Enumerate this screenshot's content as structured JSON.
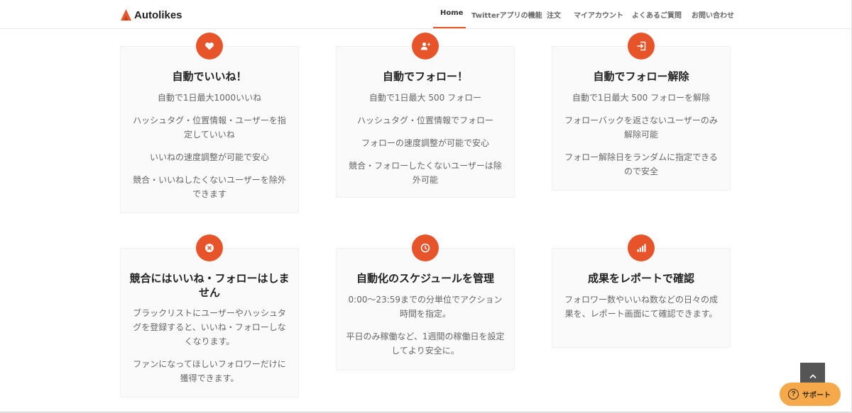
{
  "brand": {
    "name": "Autolikes"
  },
  "nav": {
    "items": [
      {
        "label": "Home",
        "active": true
      },
      {
        "label": "Twitterアプリの機能"
      },
      {
        "label": "注文"
      },
      {
        "label": "マイアカウント"
      },
      {
        "label": "よくあるご質問"
      },
      {
        "label": "お問い合わせ"
      }
    ]
  },
  "features": [
    {
      "icon": "heart-icon",
      "title": "自動でいいね！",
      "lines": [
        "自動で1日最大1000いいね",
        "ハッシュタグ・位置情報・ユーザーを指定していいね",
        "いいねの速度調整が可能で安心",
        "競合・いいねしたくないユーザーを除外できます"
      ]
    },
    {
      "icon": "add-user-icon",
      "title": "自動でフォロー！",
      "lines": [
        "自動で1日最大 500 フォロー",
        "ハッシュタグ・位置情報でフォロー",
        "フォローの速度調整が可能で安心",
        "競合・フォローしたくないユーザーは除外可能"
      ]
    },
    {
      "icon": "sign-in-icon",
      "title": "自動でフォロー解除",
      "lines": [
        "自動で1日最大 500 フォローを解除",
        "フォローバックを返さないユーザーのみ解除可能",
        "フォロー解除日をランダムに指定できるので安全"
      ]
    },
    {
      "icon": "close-circle-icon",
      "title": "競合にはいいね・フォローはしません",
      "lines": [
        "ブラックリストにユーザーやハッシュタグを登録すると、いいね・フォローしなくなります。",
        "ファンになってほしいフォロワーだけに獲得できます。"
      ]
    },
    {
      "icon": "clock-icon",
      "title": "自動化のスケジュールを管理",
      "lines": [
        "0:00〜23:59までの分単位でアクション時間を指定。",
        "平日のみ稼働など、1週間の稼働日を設定してより安全に。"
      ]
    },
    {
      "icon": "bar-chart-icon",
      "title": "成果をレポートで確認",
      "lines": [
        "フォロワー数やいいね数などの日々の成果を、レポート画面にて確認できます。"
      ]
    }
  ],
  "support": {
    "label": "サポート",
    "icon": "question-icon"
  },
  "scroll_top": {
    "icon": "chevron-up-icon"
  },
  "colors": {
    "accent": "#e8542a",
    "support": "#f6a94a",
    "card_bg": "#fafafa"
  }
}
